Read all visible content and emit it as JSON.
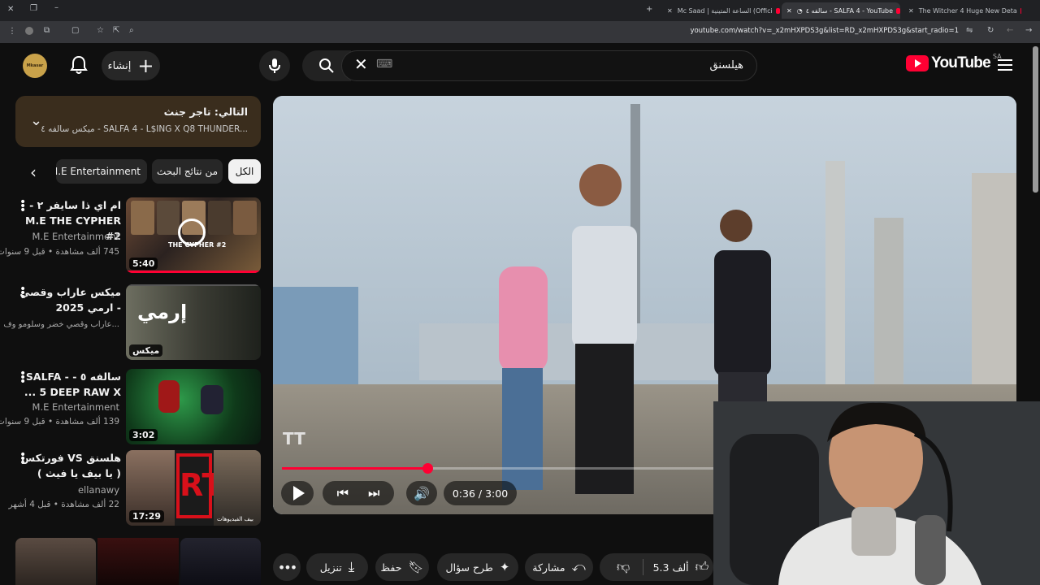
{
  "browser": {
    "tabs": [
      {
        "title": "Mc Saad | الساعة المتينية (Offici"
      },
      {
        "title": "سالفه ٤ - SALFA 4 - YouTube"
      },
      {
        "title": "The Witcher 4 Huge New Deta"
      }
    ],
    "url": "youtube.com/watch?v=_x2mHXPDS3g&list=RD_x2mHXPDS3g&start_radio=1"
  },
  "header": {
    "search_value": "هيلسنق",
    "keyboard_hint": "⌨",
    "create_label": "إنشاء",
    "logo_text": "YouTube",
    "country_code": "SA",
    "channel_avatar_text": "Mkasar"
  },
  "up_next": {
    "label": "التالي: تاجر جنث",
    "subtitle": "ميكس سالفه ٤ - SALFA 4 - L$ING X Q8 THUNDER..."
  },
  "chips": {
    "all": "الكل",
    "related": "من نتائج البحث",
    "channel": "من M.E Entertainment"
  },
  "recommendations": [
    {
      "title": "ام اي ذا سايفر ٢ - M.E THE CYPHER #2",
      "channel": "M.E Entertainment",
      "meta": "745 ألف مشاهدة • قبل 9 سنوات",
      "duration": "5:40",
      "thumb_text": "THE CYPHER #2"
    },
    {
      "title": "ميكس عاراب وقصي - ارمي 2025",
      "channel": "عاراب وقصي خضر وسلومو وف...",
      "meta": "",
      "duration": "ميكس",
      "thumb_text": "إرمي"
    },
    {
      "title": "سالفه ٥ - - SALFA 5 DEEP RAW X ...",
      "channel": "M.E Entertainment",
      "meta": "139 ألف مشاهدة • قبل 9 سنوات",
      "duration": "3:02",
      "thumb_text": ""
    },
    {
      "title": "هلسنق VS فورتكس ( يا بيف يا فيث )",
      "channel": "ellanawy",
      "meta": "22 ألف مشاهدة • قبل 4 أشهر",
      "duration": "17:29",
      "thumb_text": "بيف الفيديوهات"
    }
  ],
  "player": {
    "time": "0:36 / 3:00",
    "progress_fraction": 0.2,
    "watermark": "TT"
  },
  "actions": {
    "likes": "5.3 ألف",
    "share": "مشاركة",
    "ask": "طرح سؤال",
    "save": "حفظ",
    "download": "تنزيل"
  },
  "colors": {
    "brand_red": "#ff0033",
    "upnext_bg": "#3a2d1d"
  }
}
